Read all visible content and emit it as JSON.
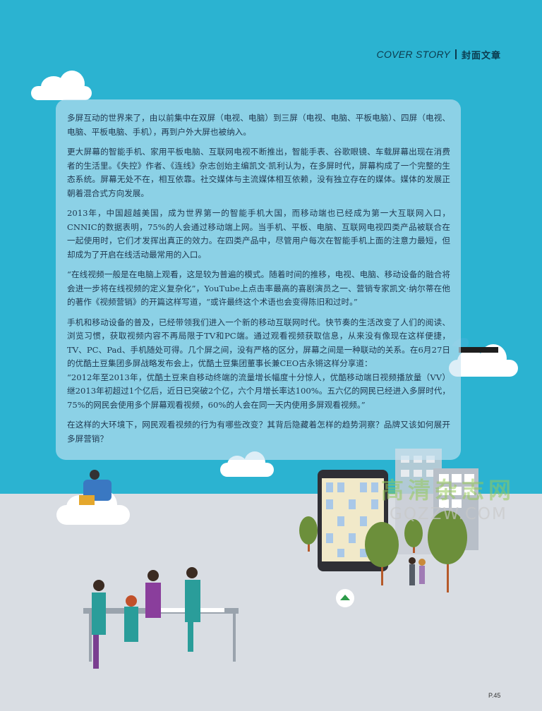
{
  "header": {
    "section_en": "COVER STORY",
    "section_cn": "封面文章"
  },
  "article": {
    "paragraphs": [
      "多屏互动的世界来了，由以前集中在双屏（电视、电脑）到三屏（电视、电脑、平板电脑）、四屏（电视、电脑、平板电脑、手机），再到户外大屏也被纳入。",
      "更大屏幕的智能手机、家用平板电脑、互联网电视不断推出，智能手表、谷歌眼镜、车载屏幕出现在消费者的生活里。《失控》作者、《连线》杂志创始主编凯文·凯利认为，在多屏时代，屏幕构成了一个完整的生态系统。屏幕无处不在，相互依靠。社交媒体与主流媒体相互依赖，没有独立存在的媒体。媒体的发展正朝着混合式方向发展。",
      "2013年，中国超越美国，成为世界第一的智能手机大国，而移动端也已经成为第一大互联网入口，CNNIC的数据表明，75%的人会通过移动端上网。当手机、平板、电脑、互联网电视四类产品被联合在一起使用时，它们才发挥出真正的效力。在四类产品中，尽管用户每次在智能手机上面的注意力最短，但却成为了开启在线活动最常用的入口。",
      "“在线视频一般是在电脑上观看，这是较为普遍的模式。随着时间的推移，电视、电脑、移动设备的融合将会进一步将在线视频的定义复杂化”，YouTube上点击率最高的喜剧演员之一、营销专家凯文·纳尔蒂在他的著作《视频营销》的开篇这样写道，“或许最终这个术语也会变得陈旧和过时。”",
      "手机和移动设备的普及，已经带领我们进入一个新的移动互联网时代。快节奏的生活改变了人们的阅读、浏览习惯，获取视频内容不再局限于TV和PC端。通过观看视频获取信息，从来没有像现在这样便捷，TV、PC、Pad、手机随处可得。几个屏之间，没有严格的区分，屏幕之间是一种联动的关系。在6月27日的优酷土豆集团多屏战略发布会上，优酷土豆集团董事长兼CEO古永锵这样分享道：",
      "“2012年至2013年，优酷土豆来自移动终端的流量增长幅度十分惊人，优酷移动端日视频播放量（VV）继2013年初超过1个亿后，近日已突破2个亿，六个月增长率达100%。五六亿的网民已经进入多屏时代，75%的网民会使用多个屏幕观看视频，60%的人会在同一天内使用多屏观看视频。”",
      "在这样的大环境下，网民观看视频的行为有哪些改变？其背后隐藏着怎样的趋势洞察？品牌又该如何展开多屏营销？"
    ]
  },
  "watermark": {
    "cn": "高清杂志网",
    "en": "GQZZW.COM"
  },
  "page_number": "P.45"
}
